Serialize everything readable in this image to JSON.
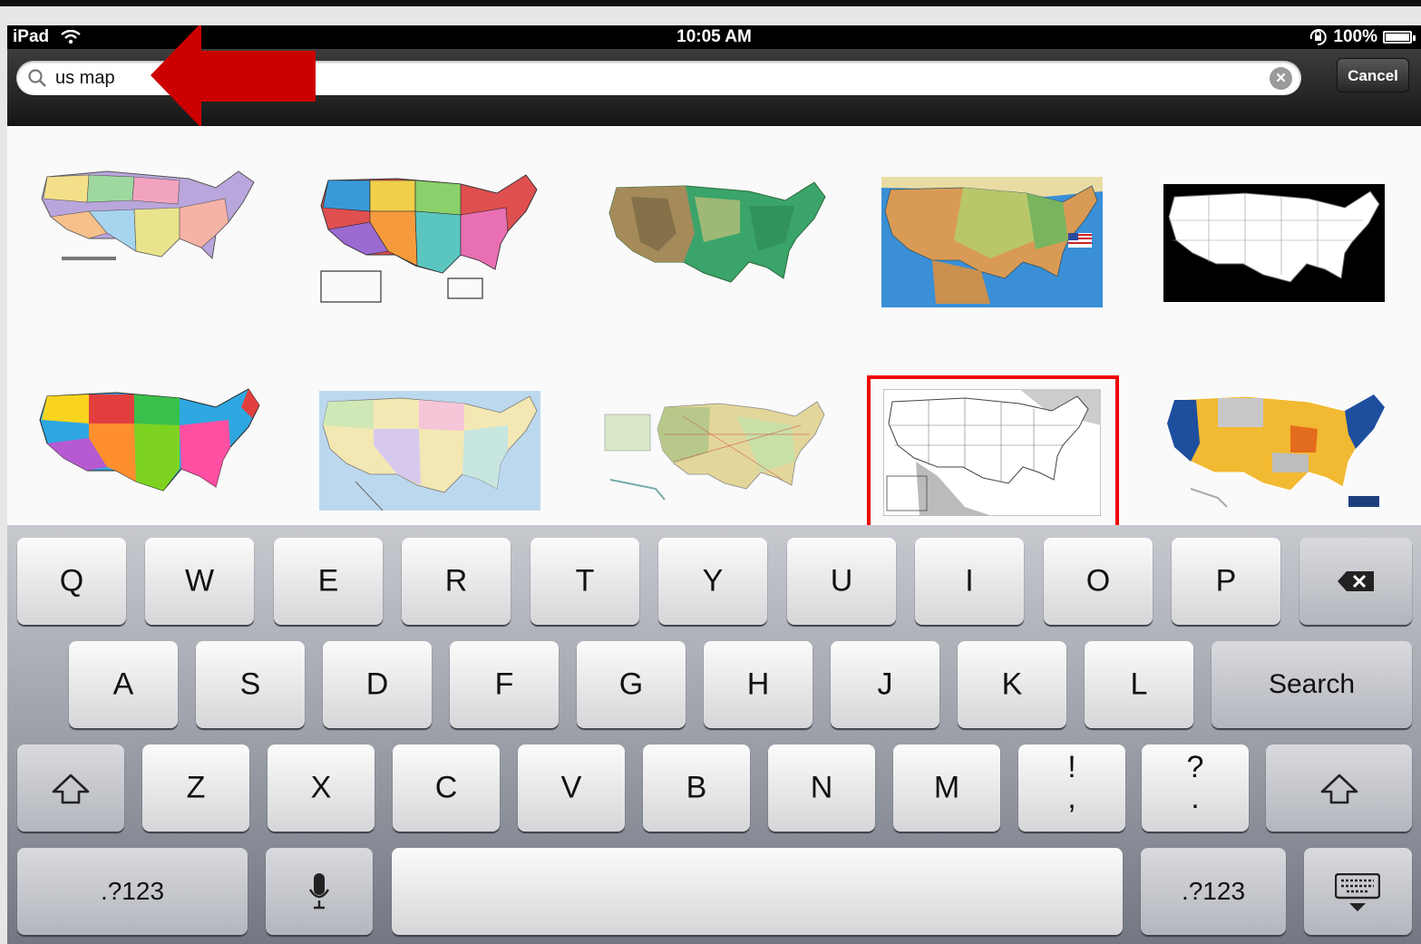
{
  "status_bar": {
    "device": "iPad",
    "time": "10:05 AM",
    "battery": "100%",
    "battery_level": 1.0,
    "icons": [
      "wifi-icon",
      "rotation-lock-icon",
      "battery-icon"
    ]
  },
  "search": {
    "query": "us map",
    "cancel_label": "Cancel",
    "icons": [
      "search-icon",
      "clear-icon"
    ]
  },
  "annotations": {
    "arrow_color": "#cc0000",
    "highlight_color": "#e00000"
  },
  "results": [
    {
      "style": "pastel"
    },
    {
      "style": "bright"
    },
    {
      "style": "terrain"
    },
    {
      "style": "physical"
    },
    {
      "style": "black-white"
    },
    {
      "style": "colorful"
    },
    {
      "style": "soft-pastel"
    },
    {
      "style": "road-atlas"
    },
    {
      "style": "outline",
      "selected": true
    },
    {
      "style": "yellow-blue"
    }
  ],
  "keyboard": {
    "row1": [
      "Q",
      "W",
      "E",
      "R",
      "T",
      "Y",
      "U",
      "I",
      "O",
      "P"
    ],
    "row2": [
      "A",
      "S",
      "D",
      "F",
      "G",
      "H",
      "J",
      "K",
      "L"
    ],
    "search_label": "Search",
    "row3": [
      "Z",
      "X",
      "C",
      "V",
      "B",
      "N",
      "M"
    ],
    "punct1_top": "!",
    "punct1_bottom": ",",
    "punct2_top": "?",
    "punct2_bottom": ".",
    "num_label": ".?123",
    "icons": [
      "backspace-icon",
      "shift-icon",
      "microphone-icon",
      "hide-keyboard-icon"
    ]
  }
}
